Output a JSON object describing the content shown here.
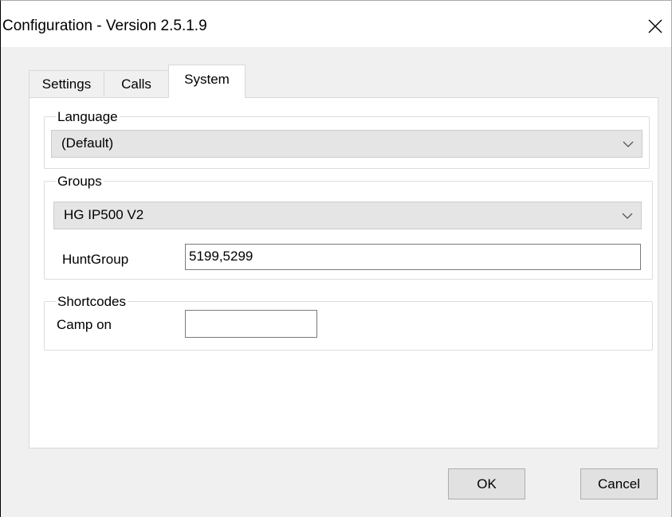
{
  "window": {
    "title": "Configuration - Version 2.5.1.9"
  },
  "tabs": [
    {
      "label": "Settings"
    },
    {
      "label": "Calls"
    },
    {
      "label": "System"
    }
  ],
  "language": {
    "legend": "Language",
    "selected": "(Default)"
  },
  "groups": {
    "legend": "Groups",
    "selected": "HG IP500 V2",
    "huntgroup_label": "HuntGroup",
    "huntgroup_value": "5199,5299"
  },
  "shortcodes": {
    "legend": "Shortcodes",
    "camp_on_label": "Camp on",
    "camp_on_value": ""
  },
  "buttons": {
    "ok": "OK",
    "cancel": "Cancel"
  },
  "icons": {
    "close": "close-icon",
    "dropdown": "chevron-down-icon"
  }
}
